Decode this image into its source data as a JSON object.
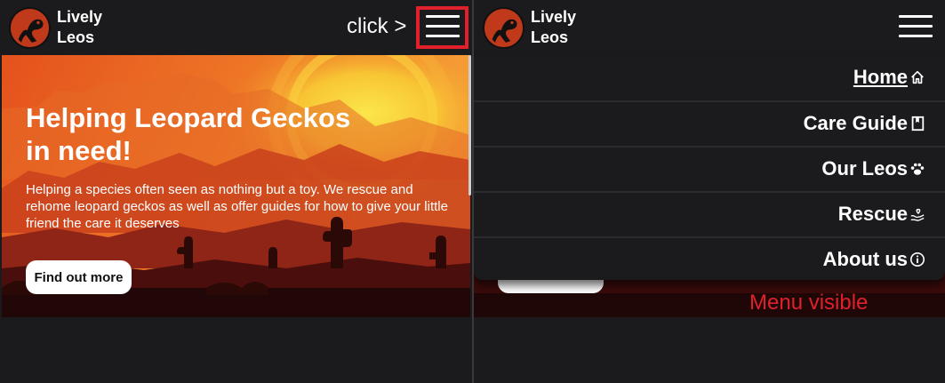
{
  "brand": {
    "line1": "Lively",
    "line2": "Leos"
  },
  "annotations": {
    "click": "click >",
    "menu_visible": "Menu visible",
    "highlight_color": "#e0202a"
  },
  "hero": {
    "title": "Helping Leopard Geckos in need!",
    "text": "Helping a species often seen as nothing but a toy. We rescue and rehome leopard geckos as well as offer guides for how to give your little friend the care it deserves",
    "button": "Find out more"
  },
  "menu": {
    "items": [
      {
        "label": "Home",
        "icon": "home-icon",
        "active": true
      },
      {
        "label": "Care Guide",
        "icon": "book-icon",
        "active": false
      },
      {
        "label": "Our Leos",
        "icon": "paw-icon",
        "active": false
      },
      {
        "label": "Rescue",
        "icon": "hand-heart-icon",
        "active": false
      },
      {
        "label": "About us",
        "icon": "info-icon",
        "active": false
      }
    ]
  },
  "colors": {
    "background": "#1b1b1e",
    "logo": "#c0391b",
    "button": "#ffffff",
    "hero_sunset": "#f08a2c"
  }
}
